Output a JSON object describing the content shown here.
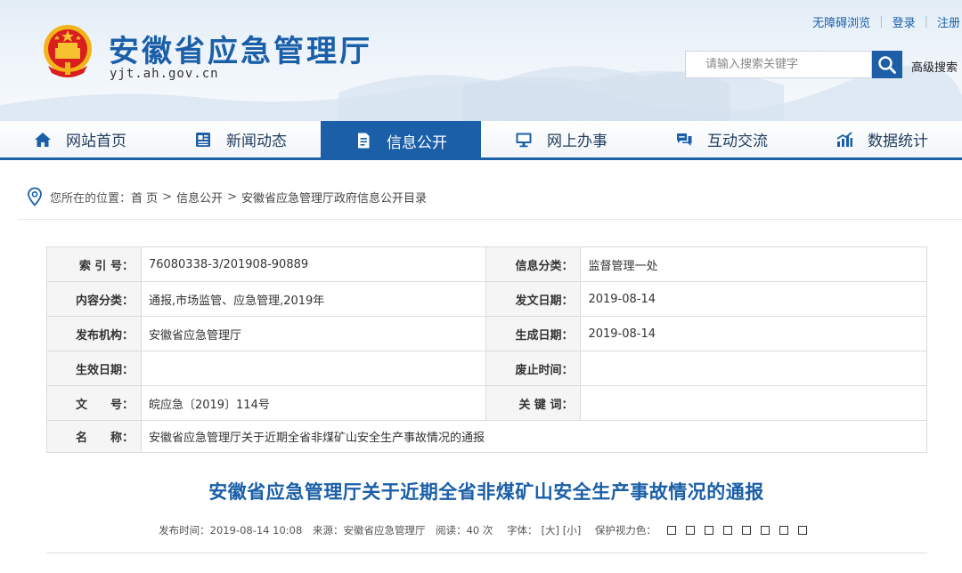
{
  "header": {
    "site_title": "安徽省应急管理厅",
    "site_domain": "yjt.ah.gov.cn",
    "toplinks": [
      "无障碍浏览",
      "登录",
      "注册"
    ],
    "search_placeholder": "请输入搜索关键字",
    "advanced_search": "高级搜索"
  },
  "nav": [
    {
      "label": "网站首页",
      "icon": "home-icon"
    },
    {
      "label": "新闻动态",
      "icon": "newspaper-icon"
    },
    {
      "label": "信息公开",
      "icon": "document-icon",
      "active": true
    },
    {
      "label": "网上办事",
      "icon": "monitor-icon"
    },
    {
      "label": "互动交流",
      "icon": "chat-icon"
    },
    {
      "label": "数据统计",
      "icon": "chart-icon"
    }
  ],
  "breadcrumb": {
    "prefix": "您所在的位置：",
    "items": [
      "首 页",
      "信息公开",
      "安徽省应急管理厅政府信息公开目录"
    ]
  },
  "info_table": {
    "index_label": "索 引 号：",
    "index_value": "76080338-3/201908-90889",
    "category_label": "信息分类：",
    "category_value": "监督管理一处",
    "content_label": "内容分类：",
    "content_value": "通报,市场监管、应急管理,2019年",
    "issue_date_label": "发文日期：",
    "issue_date_value": "2019-08-14",
    "publisher_label": "发布机构：",
    "publisher_value": "安徽省应急管理厅",
    "created_label": "生成日期：",
    "created_value": "2019-08-14",
    "effective_label": "生效日期：",
    "effective_value": "",
    "repeal_label": "废止时间：",
    "repeal_value": "",
    "docno_label": "文　　号：",
    "docno_value": "皖应急〔2019〕114号",
    "keywords_label": "关 键 词：",
    "keywords_value": "",
    "name_label": "名　　称：",
    "name_value": "安徽省应急管理厅关于近期全省非煤矿山安全生产事故情况的通报"
  },
  "article": {
    "title": "安徽省应急管理厅关于近期全省非煤矿山安全生产事故情况的通报",
    "publish_time": "发布时间：2019-08-14 10:08",
    "source": "来源：安徽省应急管理厅",
    "views": "阅读：40 次",
    "font_label": "字体：",
    "font_large": "[大]",
    "font_small": "[小]",
    "eye_protect": "保护视力色：",
    "swatch_colors": [
      "#ffffff",
      "#ffffff",
      "#ffffff",
      "#ffffff",
      "#ffffff",
      "#ffffff",
      "#ffffff",
      "#ffffff"
    ]
  },
  "colors": {
    "brand": "#1a5fa8",
    "nav_active": "#1a5fa8"
  }
}
